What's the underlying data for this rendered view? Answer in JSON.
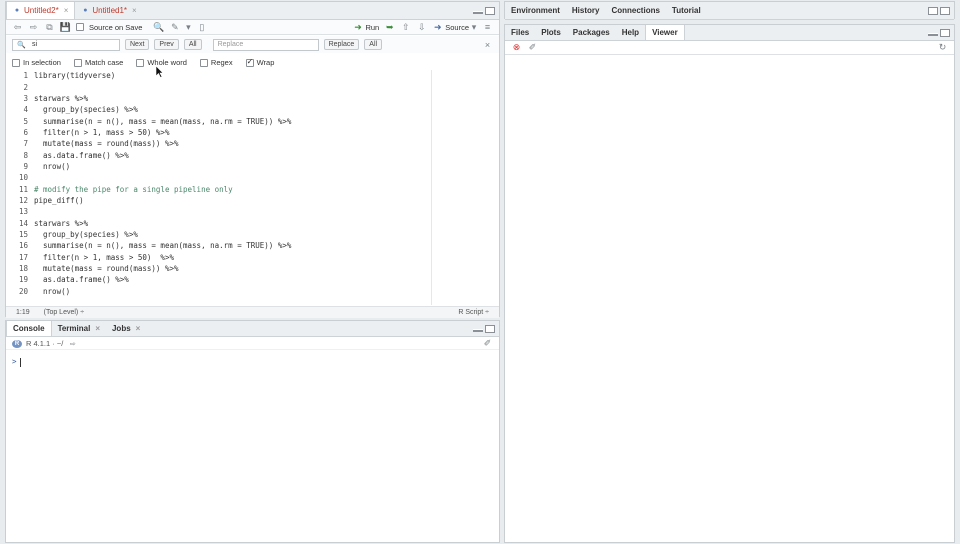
{
  "source_pane": {
    "tabs": [
      {
        "label": "Untitled2*",
        "active": true
      },
      {
        "label": "Untitled1*",
        "active": false
      }
    ],
    "toolbar": {
      "source_on_save_label": "Source on Save",
      "run_label": "Run",
      "source_label": "Source"
    },
    "find": {
      "search_value": "si",
      "next_label": "Next",
      "prev_label": "Prev",
      "all_label": "All",
      "replace_placeholder": "Replace",
      "replace_label": "Replace",
      "replace_all_label": "All",
      "in_selection_label": "In selection",
      "match_case_label": "Match case",
      "whole_word_label": "Whole word",
      "regex_label": "Regex",
      "wrap_label": "Wrap"
    },
    "code_lines": [
      {
        "n": "1",
        "text": "library(tidyverse)"
      },
      {
        "n": "2",
        "text": ""
      },
      {
        "n": "3",
        "text": "starwars %>%"
      },
      {
        "n": "4",
        "text": "  group_by(species) %>%"
      },
      {
        "n": "5",
        "text": "  summarise(n = n(), mass = mean(mass, na.rm = TRUE)) %>%"
      },
      {
        "n": "6",
        "text": "  filter(n > 1, mass > 50) %>%"
      },
      {
        "n": "7",
        "text": "  mutate(mass = round(mass)) %>%"
      },
      {
        "n": "8",
        "text": "  as.data.frame() %>%"
      },
      {
        "n": "9",
        "text": "  nrow()"
      },
      {
        "n": "10",
        "text": ""
      },
      {
        "n": "11",
        "text": "# modify the pipe for a single pipeline only"
      },
      {
        "n": "12",
        "text": "pipe_diff()"
      },
      {
        "n": "13",
        "text": ""
      },
      {
        "n": "14",
        "text": "starwars %>%"
      },
      {
        "n": "15",
        "text": "  group_by(species) %>%"
      },
      {
        "n": "16",
        "text": "  summarise(n = n(), mass = mean(mass, na.rm = TRUE)) %>%"
      },
      {
        "n": "17",
        "text": "  filter(n > 1, mass > 50)  %>%"
      },
      {
        "n": "18",
        "text": "  mutate(mass = round(mass)) %>%"
      },
      {
        "n": "19",
        "text": "  as.data.frame() %>%"
      },
      {
        "n": "20",
        "text": "  nrow()"
      }
    ],
    "status": {
      "position": "1:19",
      "scope": "(Top Level) ÷",
      "file_type": "R Script ÷"
    }
  },
  "console_pane": {
    "tabs": [
      {
        "label": "Console"
      },
      {
        "label": "Terminal"
      },
      {
        "label": "Jobs"
      }
    ],
    "r_version": "R 4.1.1 · ~/",
    "prompt": ">"
  },
  "env_pane": {
    "tabs": [
      {
        "label": "Environment"
      },
      {
        "label": "History"
      },
      {
        "label": "Connections"
      },
      {
        "label": "Tutorial"
      }
    ]
  },
  "files_pane": {
    "tabs": [
      {
        "label": "Files"
      },
      {
        "label": "Plots"
      },
      {
        "label": "Packages"
      },
      {
        "label": "Help"
      },
      {
        "label": "Viewer"
      }
    ]
  },
  "colors": {
    "accent_red": "#c0392b",
    "keyword_blue": "#3333cc",
    "comment_green": "#4c886b",
    "run_green": "#3a8f3a"
  }
}
